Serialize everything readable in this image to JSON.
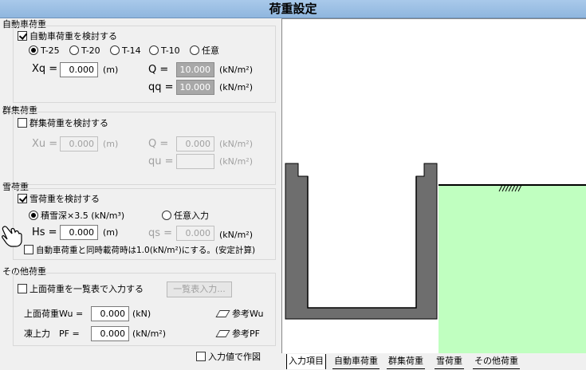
{
  "window": {
    "title": "荷重設定"
  },
  "vehicle": {
    "group_title": "自動車荷重",
    "check_label": "自動車荷重を検討する",
    "options": [
      "T-25",
      "T-20",
      "T-14",
      "T-10",
      "任意"
    ],
    "selected": "T-25",
    "xq_label": "Xq =",
    "xq_value": "0.000",
    "xq_unit": "(m)",
    "q_label": "Q =",
    "q_value": "10.000",
    "q_unit": "(kN/m²)",
    "qq_label": "qq =",
    "qq_value": "10.000",
    "qq_unit": "(kN/m²)"
  },
  "crowd": {
    "group_title": "群集荷重",
    "check_label": "群集荷重を検討する",
    "xu_label": "Xu =",
    "xu_value": "0.000",
    "xu_unit": "(m)",
    "q_label": "Q =",
    "q_value": "0.000",
    "q_unit": "(kN/m²)",
    "qu_label": "qu =",
    "qu_value": "",
    "qu_unit": "(kN/m²)"
  },
  "snow": {
    "group_title": "雪荷重",
    "check_label": "雪荷重を検討する",
    "option_depth": "積雪深×3.5 (kN/m³)",
    "option_free": "任意入力",
    "hs_label": "Hs =",
    "hs_value": "0.000",
    "hs_unit": "(m)",
    "qs_label": "qs =",
    "qs_value": "0.000",
    "qs_unit": "(kN/m²)",
    "combo_label": "自動車荷重と同時載荷時は1.0(kN/m²)にする。(安定計算)"
  },
  "other": {
    "group_title": "その他荷重",
    "check_label": "上面荷重を一覧表で入力する",
    "list_button": "一覧表入力...",
    "wu_label": "上面荷重Wu =",
    "wu_value": "0.000",
    "wu_unit": "(kN)",
    "pf_label": "凍上力　PF =",
    "pf_value": "0.000",
    "pf_unit": "(kN/m²)",
    "ref_wu": "参考Wu",
    "ref_pf": "参考PF"
  },
  "draw_input_label": "入力値で作図",
  "tabs": [
    "入力項目",
    "自動車荷重",
    "群集荷重",
    "雪荷重",
    "その他荷重"
  ],
  "colors": {
    "structure": "#6e6e6e",
    "ground": "#c0ffc0",
    "title_bar": "#9ec1e6"
  }
}
